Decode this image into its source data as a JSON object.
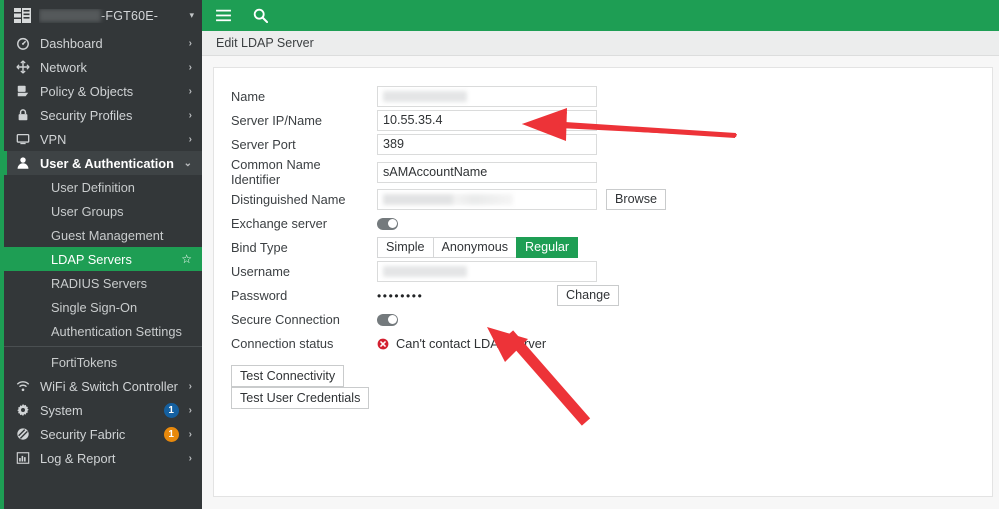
{
  "sidebar": {
    "device_name": "-FGT60E-",
    "device_redacted": true,
    "caret": "▾",
    "items": [
      {
        "label": "Dashboard",
        "icon": "dashboard-icon",
        "chevron": "›"
      },
      {
        "label": "Network",
        "icon": "network-icon",
        "chevron": "›"
      },
      {
        "label": "Policy & Objects",
        "icon": "policy-icon",
        "chevron": "›"
      },
      {
        "label": "Security Profiles",
        "icon": "shield-lock-icon",
        "chevron": "›"
      },
      {
        "label": "VPN",
        "icon": "monitor-icon",
        "chevron": "›"
      },
      {
        "label": "User & Authentication",
        "icon": "user-icon",
        "chevron": "⌄",
        "expanded": true
      }
    ],
    "sub_items": [
      {
        "label": "User Definition"
      },
      {
        "label": "User Groups"
      },
      {
        "label": "Guest Management"
      },
      {
        "label": "LDAP Servers",
        "selected": true,
        "star": "☆"
      },
      {
        "label": "RADIUS Servers"
      },
      {
        "label": "Single Sign-On"
      },
      {
        "label": "Authentication Settings"
      }
    ],
    "sub_items_after_sep": [
      {
        "label": "FortiTokens"
      }
    ],
    "items_bottom": [
      {
        "label": "WiFi & Switch Controller",
        "icon": "wifi-icon",
        "chevron": "›",
        "badge": null,
        "badge_color": null
      },
      {
        "label": "System",
        "icon": "gear-icon",
        "chevron": "›",
        "badge": "1",
        "badge_color": "#1560a0"
      },
      {
        "label": "Security Fabric",
        "icon": "fabric-icon",
        "chevron": "›",
        "badge": "1",
        "badge_color": "#e8890c"
      },
      {
        "label": "Log & Report",
        "icon": "chart-bar-icon",
        "chevron": "›",
        "badge": null,
        "badge_color": null
      }
    ]
  },
  "topbar": {
    "menu_icon": "hamburger-menu-icon",
    "search_icon": "search-icon",
    "accent_color": "#1e9e54"
  },
  "breadcrumb": {
    "title": "Edit LDAP Server"
  },
  "form": {
    "fields": {
      "name_label": "Name",
      "name_value": "",
      "server_ip_label": "Server IP/Name",
      "server_ip_value": "10.55.35.4",
      "server_port_label": "Server Port",
      "server_port_value": "389",
      "cn_identifier_label": "Common Name Identifier",
      "cn_identifier_value": "sAMAccountName",
      "dn_label": "Distinguished Name",
      "dn_value": "",
      "browse_label": "Browse",
      "exchange_label": "Exchange server",
      "exchange_state": "off",
      "bind_type_label": "Bind Type",
      "bind_options": [
        "Simple",
        "Anonymous",
        "Regular"
      ],
      "bind_selected": "Regular",
      "username_label": "Username",
      "username_value": "",
      "password_label": "Password",
      "password_value": "••••••••",
      "change_label": "Change",
      "secure_connection_label": "Secure Connection",
      "secure_connection_state": "off",
      "connection_status_label": "Connection status",
      "connection_status_value": "Can't contact LDAP server",
      "connection_status_icon": "error-circle-icon",
      "connection_status_color": "#d32030"
    },
    "buttons": {
      "test_connectivity": "Test Connectivity",
      "test_user_credentials": "Test User Credentials"
    }
  },
  "annotations": {
    "arrow_color": "#ed3338",
    "arrow_1_target": "server-ip-name-field",
    "arrow_2_target": "connection-status-value"
  }
}
